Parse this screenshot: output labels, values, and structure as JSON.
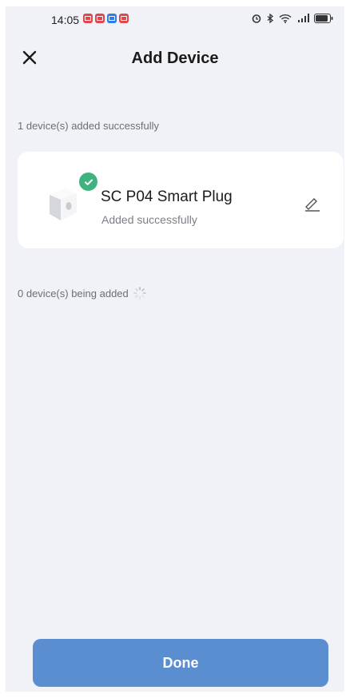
{
  "status_bar": {
    "time": "14:05",
    "notification_icons": [
      "app-notification-icon",
      "app-notification-icon",
      "app-notification-icon",
      "app-notification-icon"
    ],
    "system_icons": [
      "alarm-icon",
      "bluetooth-icon",
      "wifi-icon",
      "signal-icon",
      "battery-icon"
    ],
    "battery_level": "80"
  },
  "header": {
    "title": "Add Device",
    "close_icon": "close-icon"
  },
  "added_section": {
    "label": "1 device(s) added successfully",
    "devices": [
      {
        "name": "SC P04 Smart Plug",
        "status": "Added successfully",
        "image": "smart-plug-image",
        "badge_icon": "check-icon",
        "edit_icon": "edit-icon"
      }
    ]
  },
  "adding_section": {
    "label": "0 device(s) being added",
    "spinner_icon": "loading-spinner-icon"
  },
  "footer": {
    "done_label": "Done"
  },
  "colors": {
    "background": "#f1f2f7",
    "card": "#ffffff",
    "primary_button": "#5a8ed1",
    "success_badge": "#3fb37f",
    "secondary_text": "#6b6e77"
  }
}
